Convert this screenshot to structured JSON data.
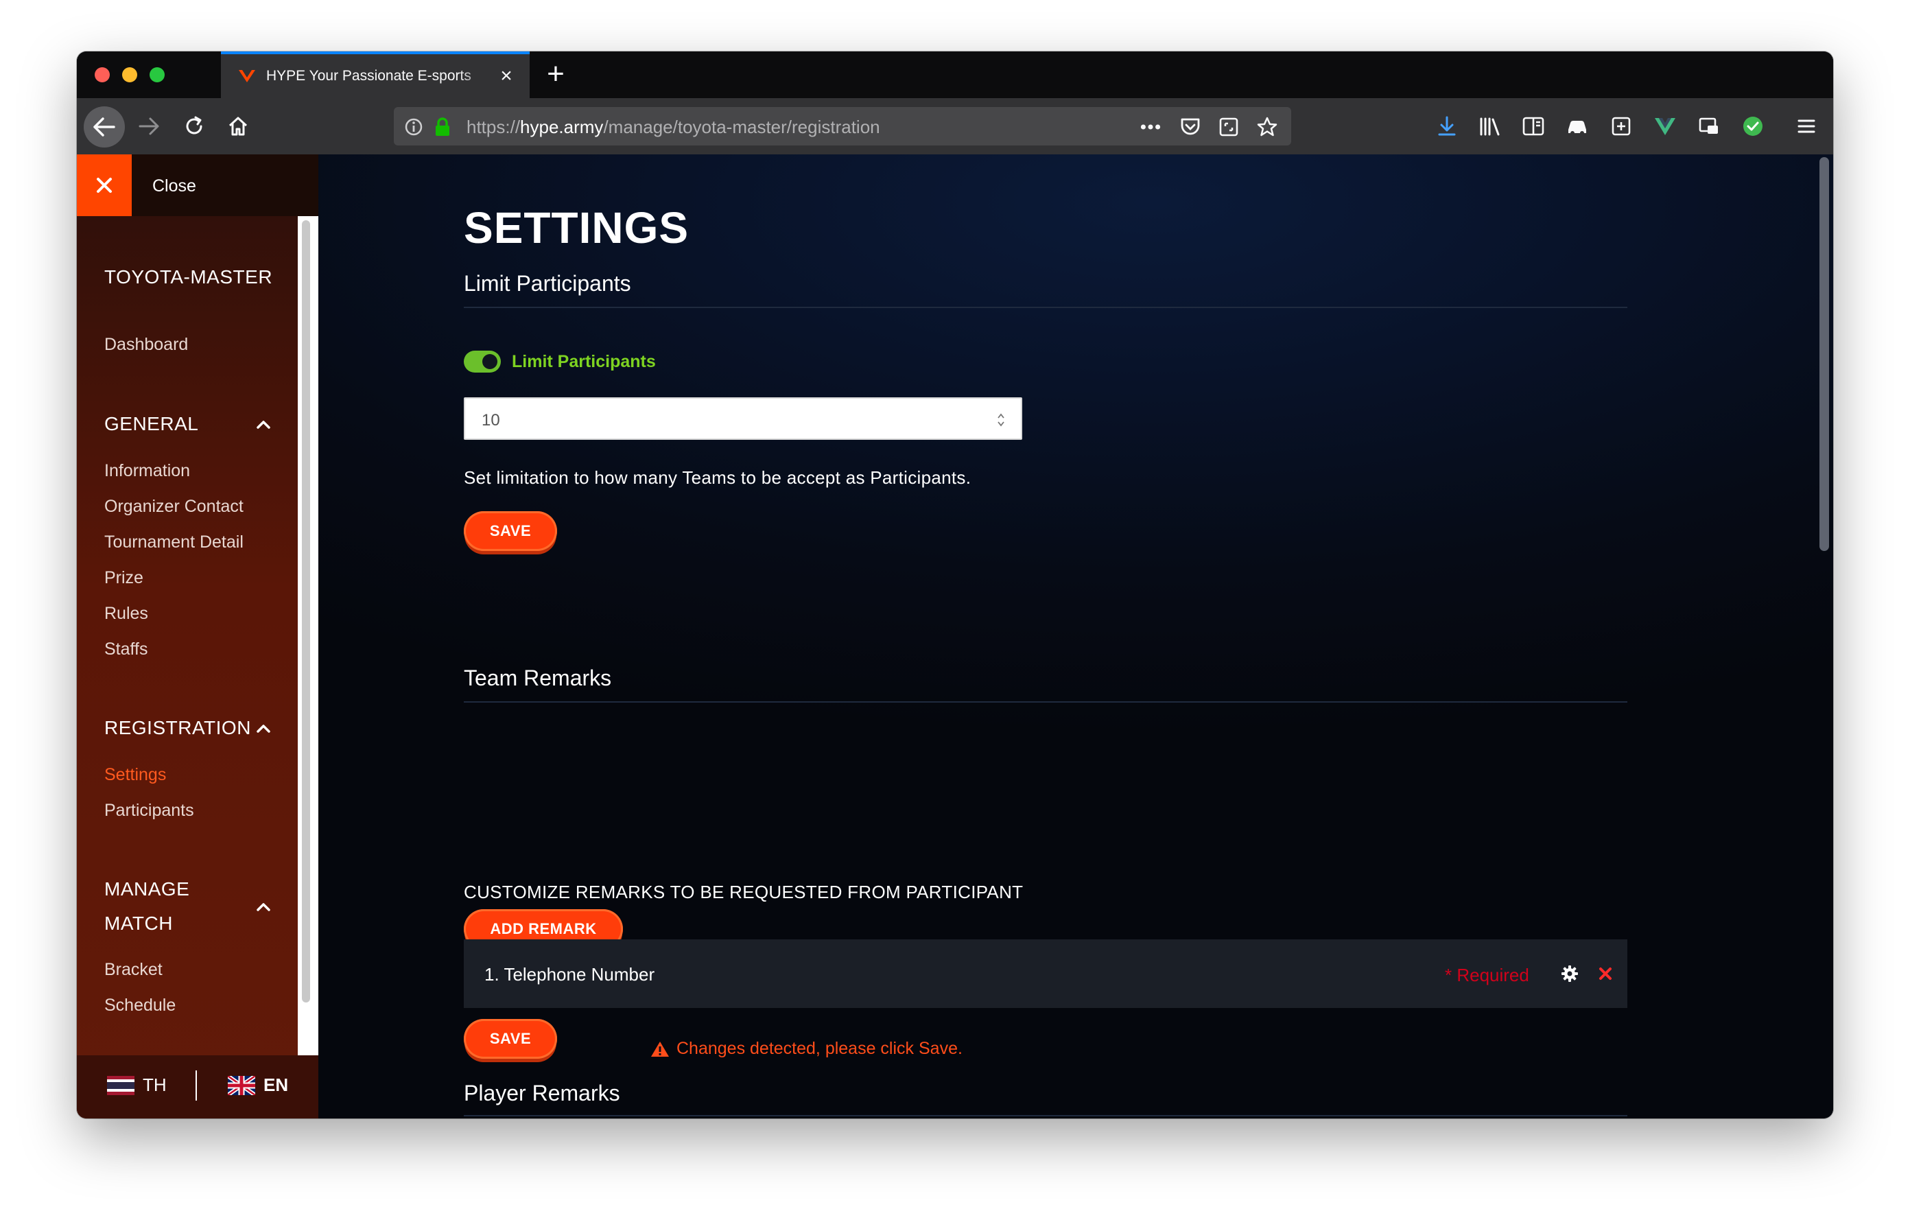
{
  "browser": {
    "tab": {
      "title": "HYPE Your Passionate E-sports",
      "favicon": "hype-v-logo"
    },
    "url": {
      "scheme": "https://",
      "host": "hype.army",
      "path": "/manage/toyota-master/registration"
    },
    "accent_color": "#0a84ff"
  },
  "sidebar": {
    "close_label": "Close",
    "tournament": "TOYOTA-MASTER",
    "dashboard": "Dashboard",
    "sections": {
      "general": {
        "title": "GENERAL",
        "items": [
          "Information",
          "Organizer Contact",
          "Tournament Detail",
          "Prize",
          "Rules",
          "Staffs"
        ]
      },
      "registration": {
        "title": "REGISTRATION",
        "items": [
          "Settings",
          "Participants"
        ],
        "active": "Settings"
      },
      "manage_match": {
        "title_line1": "MANAGE",
        "title_line2": "MATCH",
        "items": [
          "Bracket",
          "Schedule"
        ]
      }
    },
    "languages": [
      {
        "code": "TH",
        "flag": "thailand-flag"
      },
      {
        "code": "EN",
        "flag": "uk-flag"
      }
    ],
    "accent_color": "#ff4500"
  },
  "main": {
    "title": "SETTINGS",
    "limit_participants": {
      "heading": "Limit Participants",
      "toggle_label": "Limit Participants",
      "toggle_on": true,
      "value": "10",
      "help": "Set limitation to how many Teams to be accept as Participants.",
      "save_label": "SAVE"
    },
    "team_remarks": {
      "heading": "Team Remarks",
      "subheading": "CUSTOMIZE REMARKS TO BE REQUESTED FROM PARTICIPANT",
      "add_label": "ADD REMARK",
      "remarks": [
        {
          "name": "1. Telephone Number",
          "required_label": "* Required"
        }
      ],
      "save_label": "SAVE",
      "warning": "Changes detected, please click Save."
    },
    "player_remarks": {
      "heading": "Player Remarks"
    },
    "colors": {
      "toggle_on": "#7ed321",
      "button": "#ff3d0a",
      "warning": "#ff4d1a",
      "required": "#d0021b"
    }
  }
}
